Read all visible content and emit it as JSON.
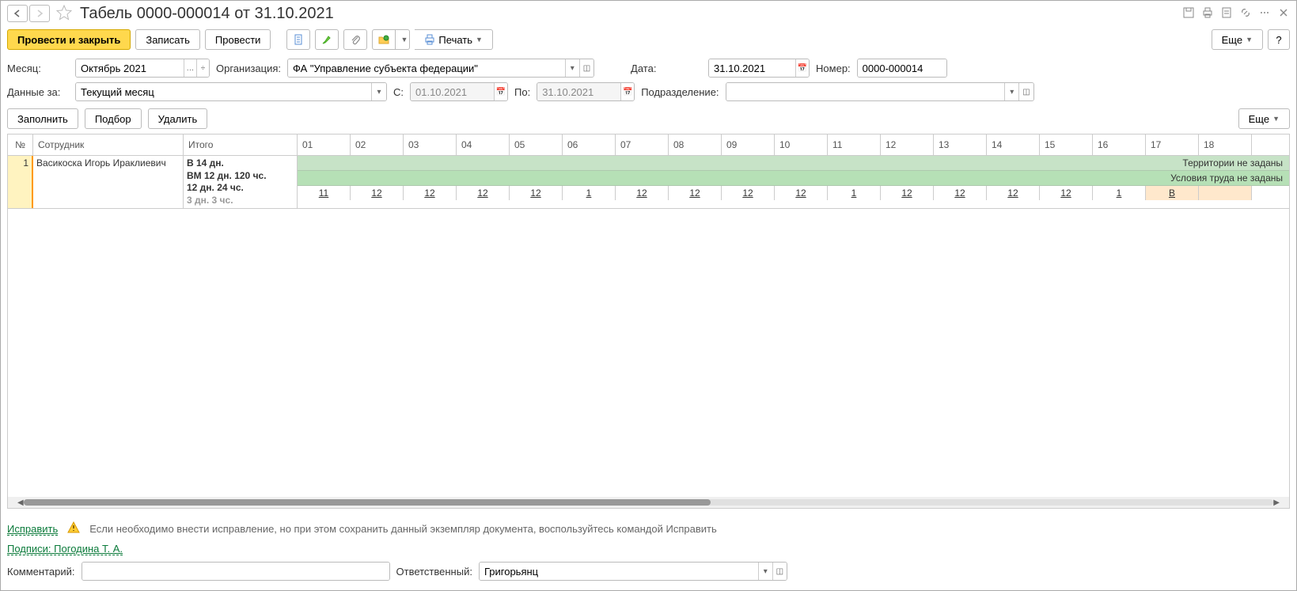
{
  "header": {
    "title": "Табель 0000-000014 от 31.10.2021"
  },
  "toolbar": {
    "post_and_close": "Провести и закрыть",
    "write": "Записать",
    "post": "Провести",
    "print": "Печать",
    "more": "Еще",
    "help": "?"
  },
  "form": {
    "month_label": "Месяц:",
    "month_value": "Октябрь 2021",
    "org_label": "Организация:",
    "org_value": "ФА \"Управление субъекта федерации\"",
    "date_label": "Дата:",
    "date_value": "31.10.2021",
    "number_label": "Номер:",
    "number_value": "0000-000014",
    "data_for_label": "Данные за:",
    "data_for_value": "Текущий месяц",
    "from_label": "С:",
    "from_value": "01.10.2021",
    "to_label": "По:",
    "to_value": "31.10.2021",
    "subdivision_label": "Подразделение:",
    "subdivision_value": ""
  },
  "table_toolbar": {
    "fill": "Заполнить",
    "pick": "Подбор",
    "delete": "Удалить",
    "more": "Еще"
  },
  "table": {
    "headers": {
      "num": "№",
      "employee": "Сотрудник",
      "total": "Итого",
      "days": [
        "01",
        "02",
        "03",
        "04",
        "05",
        "06",
        "07",
        "08",
        "09",
        "10",
        "11",
        "12",
        "13",
        "14",
        "15",
        "16",
        "17",
        "18"
      ]
    },
    "banner1": "Территории не заданы",
    "banner2": "Условия труда не заданы",
    "rows": [
      {
        "num": "1",
        "employee": "Васикоска Игорь Ираклиевич",
        "total_line1": "В 14 дн.",
        "total_line2": "ВМ 12 дн. 120 чс.",
        "total_line3": "12 дн. 24 чс.",
        "total_line4": "3 дн. 3 чс.",
        "days": [
          {
            "v": "11",
            "w": false
          },
          {
            "v": "12",
            "w": false
          },
          {
            "v": "12",
            "w": false
          },
          {
            "v": "12",
            "w": false
          },
          {
            "v": "12",
            "w": false
          },
          {
            "v": "1",
            "w": false
          },
          {
            "v": "12",
            "w": false
          },
          {
            "v": "12",
            "w": false
          },
          {
            "v": "12",
            "w": false
          },
          {
            "v": "12",
            "w": false
          },
          {
            "v": "1",
            "w": false
          },
          {
            "v": "12",
            "w": false
          },
          {
            "v": "12",
            "w": false
          },
          {
            "v": "12",
            "w": false
          },
          {
            "v": "12",
            "w": false
          },
          {
            "v": "1",
            "w": false
          },
          {
            "v": "В",
            "w": true
          },
          {
            "v": "",
            "w": true
          }
        ]
      }
    ]
  },
  "footer": {
    "fix_link": "Исправить",
    "fix_text": "Если необходимо внести исправление, но при этом сохранить данный экземпляр документа, воспользуйтесь командой Исправить",
    "sign_link": "Подписи: Погодина Т. А.",
    "comment_label": "Комментарий:",
    "comment_value": "",
    "responsible_label": "Ответственный:",
    "responsible_value": "Григорьянц"
  }
}
